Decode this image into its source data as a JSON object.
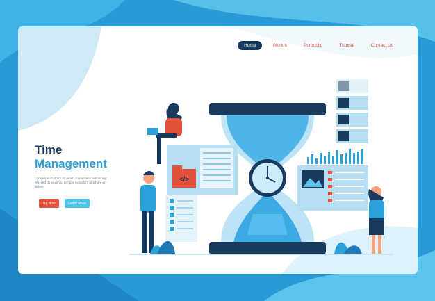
{
  "nav": {
    "items": [
      {
        "label": "Home",
        "active": true
      },
      {
        "label": "Work It",
        "active": false
      },
      {
        "label": "Portofolio",
        "active": false
      },
      {
        "label": "Tutorial",
        "active": false
      },
      {
        "label": "Contact Us",
        "active": false
      }
    ]
  },
  "hero": {
    "title_line1": "Time",
    "title_line2": "Management",
    "body": "Lorem ipsum dolor sit amet, consectetur adipiscing elit, sed do eiusmod tempor incididunt ut labore et dolore.",
    "cta_primary": "Try Now",
    "cta_secondary": "Learn More"
  },
  "colors": {
    "brand_dark": "#173a5e",
    "brand_blue": "#2aa1d9",
    "accent_red": "#e4513a",
    "accent_light": "#4cc3e8"
  },
  "icons": {
    "code": "code-icon"
  },
  "illustration_text": {
    "code_symbol": "</>"
  }
}
